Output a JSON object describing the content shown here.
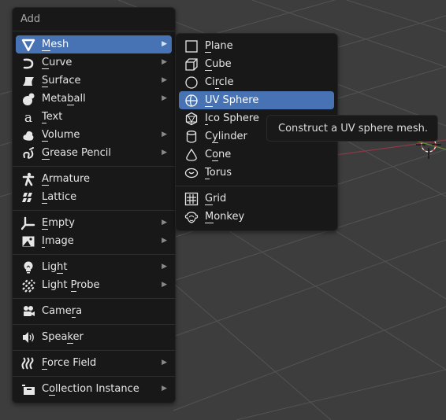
{
  "viewport": {
    "background_color": "#3d3d3d",
    "grid_color": "#555555",
    "x_axis_color": "#9a3a44",
    "y_axis_color": "#6d8f3a"
  },
  "main_menu": {
    "title": "Add",
    "groups": [
      [
        {
          "label": "Mesh",
          "mnemonic": "M",
          "icon": "mesh-icon",
          "submenu": true,
          "active": true
        },
        {
          "label": "Curve",
          "mnemonic": "C",
          "icon": "curve-icon",
          "submenu": true
        },
        {
          "label": "Surface",
          "mnemonic": "S",
          "icon": "surface-icon",
          "submenu": true
        },
        {
          "label": "Metaball",
          "mnemonic": "b",
          "icon": "metaball-icon",
          "submenu": true
        },
        {
          "label": "Text",
          "mnemonic": "T",
          "icon": "text-icon",
          "submenu": false
        },
        {
          "label": "Volume",
          "mnemonic": "V",
          "icon": "volume-icon",
          "submenu": true
        },
        {
          "label": "Grease Pencil",
          "mnemonic": "G",
          "icon": "grease-pencil-icon",
          "submenu": true
        }
      ],
      [
        {
          "label": "Armature",
          "mnemonic": "A",
          "icon": "armature-icon",
          "submenu": false
        },
        {
          "label": "Lattice",
          "mnemonic": "L",
          "icon": "lattice-icon",
          "submenu": false
        }
      ],
      [
        {
          "label": "Empty",
          "mnemonic": "E",
          "icon": "empty-icon",
          "submenu": true
        },
        {
          "label": "Image",
          "mnemonic": "I",
          "icon": "image-icon",
          "submenu": true
        }
      ],
      [
        {
          "label": "Light",
          "mnemonic": "h",
          "icon": "light-icon",
          "submenu": true
        },
        {
          "label": "Light Probe",
          "mnemonic": "P",
          "icon": "light-probe-icon",
          "submenu": true
        }
      ],
      [
        {
          "label": "Camera",
          "mnemonic": "r",
          "icon": "camera-icon",
          "submenu": false
        }
      ],
      [
        {
          "label": "Speaker",
          "mnemonic": "k",
          "icon": "speaker-icon",
          "submenu": false
        }
      ],
      [
        {
          "label": "Force Field",
          "mnemonic": "F",
          "icon": "force-field-icon",
          "submenu": true
        }
      ],
      [
        {
          "label": "Collection Instance",
          "mnemonic": "o",
          "icon": "collection-instance-icon",
          "submenu": true
        }
      ]
    ]
  },
  "mesh_submenu": {
    "groups": [
      [
        {
          "label": "Plane",
          "mnemonic": "P",
          "icon": "plane-icon"
        },
        {
          "label": "Cube",
          "mnemonic": "C",
          "icon": "cube-icon"
        },
        {
          "label": "Circle",
          "mnemonic": "r",
          "icon": "circle-icon"
        },
        {
          "label": "UV Sphere",
          "mnemonic": "U",
          "icon": "uv-sphere-icon",
          "active": true
        },
        {
          "label": "Ico Sphere",
          "mnemonic": "I",
          "icon": "ico-sphere-icon"
        },
        {
          "label": "Cylinder",
          "mnemonic": "y",
          "icon": "cylinder-icon"
        },
        {
          "label": "Cone",
          "mnemonic": "o",
          "icon": "cone-icon"
        },
        {
          "label": "Torus",
          "mnemonic": "T",
          "icon": "torus-icon"
        }
      ],
      [
        {
          "label": "Grid",
          "mnemonic": "G",
          "icon": "grid-icon"
        },
        {
          "label": "Monkey",
          "mnemonic": "M",
          "icon": "monkey-icon"
        }
      ]
    ]
  },
  "tooltip": {
    "text": "Construct a UV sphere mesh."
  },
  "colors": {
    "menu_bg": "#181818",
    "highlight": "#4772b3",
    "text": "#e6e6e6",
    "title_text": "#a8a8a8"
  }
}
